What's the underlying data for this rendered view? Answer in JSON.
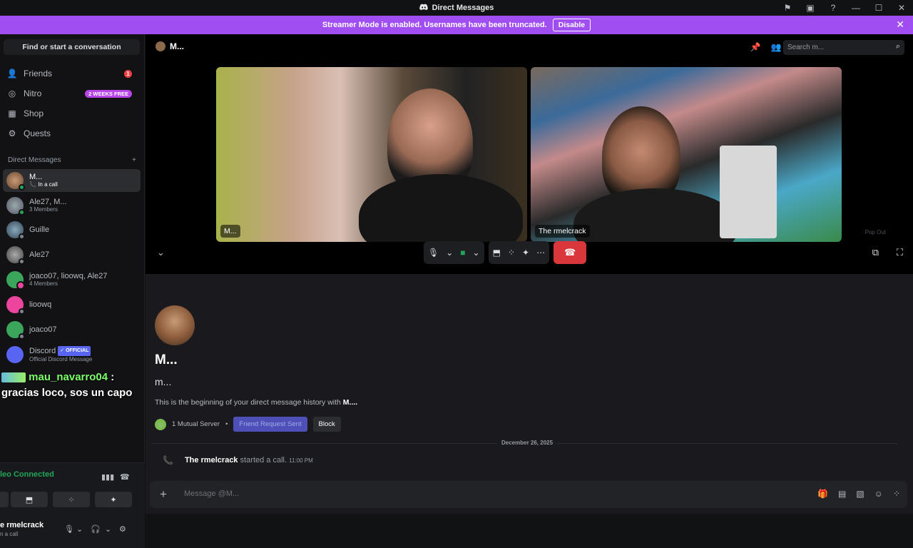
{
  "titlebar": {
    "title": "Direct Messages"
  },
  "banner": {
    "text": "Streamer Mode is enabled. Usernames have been truncated.",
    "button": "Disable"
  },
  "sidebar": {
    "find": "Find or start a conversation",
    "nav": [
      {
        "label": "Friends",
        "badge": "1"
      },
      {
        "label": "Nitro",
        "badge": "2 WEEKS FREE"
      },
      {
        "label": "Shop"
      },
      {
        "label": "Quests"
      }
    ],
    "dm_header": "Direct Messages",
    "dms": [
      {
        "name": "M...",
        "sub": "In a call"
      },
      {
        "name": "Ale27, M...",
        "sub": "3 Members"
      },
      {
        "name": "Guille",
        "sub": ""
      },
      {
        "name": "Ale27",
        "sub": ""
      },
      {
        "name": "joaco07, lioowq, Ale27",
        "sub": "4 Members"
      },
      {
        "name": "lioowq",
        "sub": ""
      },
      {
        "name": "joaco07",
        "sub": ""
      },
      {
        "name": "Discord",
        "official": "OFFICIAL",
        "sub": "Official Discord Message"
      }
    ]
  },
  "overlay_chat": {
    "user": "mau_navarro04",
    "sep": ":",
    "message": "gracias loco, sos un capo"
  },
  "voice": {
    "status": "leo Connected",
    "user": "e rmelcrack",
    "user_sub": "n a call"
  },
  "channel": {
    "name": "M...",
    "search_placeholder": "Search m..."
  },
  "call": {
    "tiles": [
      {
        "label": "M..."
      },
      {
        "label": "The rmelcrack"
      }
    ],
    "popout": "Pop Out"
  },
  "profile": {
    "display_name": "M...",
    "username": "m...",
    "desc_prefix": "This is the beginning of your direct message history with ",
    "desc_name": "M....",
    "mutual": "1 Mutual Server",
    "friend_btn": "Friend Request Sent",
    "block_btn": "Block"
  },
  "messages": {
    "date": "December 26, 2025",
    "call_user": "The rmelcrack",
    "call_text": "started a call.",
    "call_time": "11:00 PM"
  },
  "composer": {
    "placeholder": "Message @M..."
  }
}
